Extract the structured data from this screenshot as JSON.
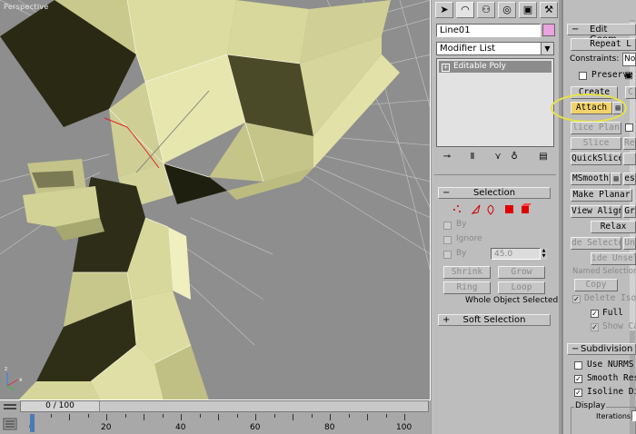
{
  "viewport": {
    "label": "Perspective"
  },
  "timeline": {
    "frame_text": "0 / 100",
    "ticks": [
      "0",
      "20",
      "40",
      "60",
      "80",
      "100"
    ]
  },
  "command_panel": {
    "tabs": [
      "create-icon",
      "modify-icon",
      "hierarchy-icon",
      "motion-icon",
      "display-icon",
      "utilities-icon"
    ],
    "object_name": "Line01",
    "object_color": "#e9a3de",
    "modifier_list": "Modifier List",
    "stack_item": "Editable Poly",
    "selection": {
      "title": "Selection",
      "by_vertex": "By",
      "ignore": "Ignore",
      "by_angle": "By",
      "angle_value": "45.0",
      "shrink": "Shrink",
      "grow": "Grow",
      "ring": "Ring",
      "loop": "Loop",
      "status": "Whole Object Selected"
    },
    "soft_selection": {
      "title": "Soft Selection"
    }
  },
  "edit_geometry": {
    "title": "Edit Geom",
    "repeat_last": "Repeat L",
    "constraints_label": "Constraints:",
    "constraints_value": "No",
    "preserve": "Preserve",
    "create": "Create",
    "collapse": "C",
    "attach": "Attach",
    "slice_plane": "lice Plan",
    "slice": "Slice",
    "reset": "Res",
    "quickslice": "QuickSlice",
    "cut": "",
    "msmooth": "MSmooth",
    "tessellate": "es",
    "make_planar": "Make Planar",
    "view_align": "View Align",
    "grid_align": "Gr",
    "relax": "Relax",
    "hide_selected": "de Selecte",
    "unhide_all": "Un",
    "hide_unselected": "ide Unsel",
    "named_selections": "Named Selections:",
    "copy": "Copy",
    "delete_isolated": "Delete Iso",
    "full": "Full",
    "show_cage": "Show Ca"
  },
  "subdivision": {
    "title": "Subdivision",
    "use_nurms": "Use NURMS",
    "smooth_result": "Smooth Res",
    "isoline_display": "Isoline Di",
    "display_group": "Display",
    "iterations_label": "Iterations:"
  },
  "colors": {
    "highlight": "#f2d36a",
    "callout": "#e6e24a",
    "mesh": "#dcdca0",
    "mesh_dark": "#2c2c18"
  }
}
